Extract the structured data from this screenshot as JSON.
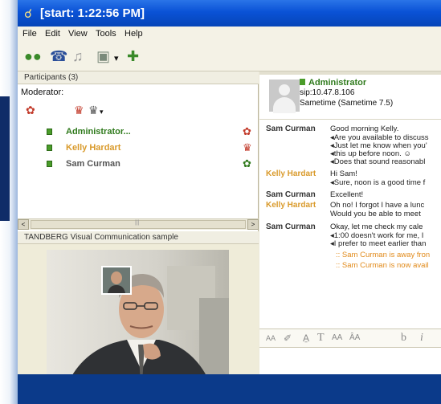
{
  "window": {
    "title": "[start: 1:22:56 PM]"
  },
  "menu": [
    "File",
    "Edit",
    "View",
    "Tools",
    "Help"
  ],
  "toolbar": {
    "icons": [
      "people-icon",
      "phone-icon",
      "speaker-icon",
      "screen-share-icon",
      "chevron-down-icon",
      "add-person-icon"
    ],
    "dropdown": "▾"
  },
  "participants": {
    "header": "Participants (3)",
    "moderator_label": "Moderator:",
    "tool_dropdown": "▾",
    "list": [
      {
        "name": "Administrator...",
        "color": "#2f7a1c"
      },
      {
        "name": "Kelly Hardart",
        "color": "#d99a2b"
      },
      {
        "name": "Sam Curman",
        "color": "#555555"
      }
    ]
  },
  "scrollbar": {
    "left": "<",
    "right": ">",
    "grip": "|||"
  },
  "video": {
    "header": "TANDBERG Visual Communication sample"
  },
  "profile": {
    "name": "Administrator",
    "sip": "sip:10.47.8.106",
    "status": "Sametime (Sametime 7.5)"
  },
  "chat": [
    {
      "sender": "Sam Curman",
      "color": "#333333",
      "lines": [
        "Good morning Kelly.",
        "◂Are you available to discuss",
        "◂Just let me know when you'",
        "◂this up before noon. ☺",
        "◂Does that sound reasonabl"
      ]
    },
    {
      "sender": "Kelly Hardart",
      "color": "#d99a2b",
      "lines": [
        "Hi Sam!",
        "◂Sure, noon is a good time f"
      ]
    },
    {
      "sender": "Sam Curman",
      "color": "#333333",
      "lines": [
        "Excellent!"
      ]
    },
    {
      "sender": "Kelly Hardart",
      "color": "#d99a2b",
      "lines": [
        "Oh no! I forgot I have a lunc",
        "Would you be able to meet"
      ]
    },
    {
      "sender": "Sam Curman",
      "color": "#333333",
      "lines": [
        "Okay, let me check my cale",
        "◂1:00 doesn't work for me, I",
        "◂I prefer to meet earlier than"
      ]
    }
  ],
  "system_messages": [
    ":: Sam Curman is away fron",
    ":: Sam Curman is now avail"
  ],
  "format_bar": [
    "AA",
    "✐",
    "A̱",
    "T",
    "AA",
    "ÂA",
    "b",
    "i"
  ]
}
